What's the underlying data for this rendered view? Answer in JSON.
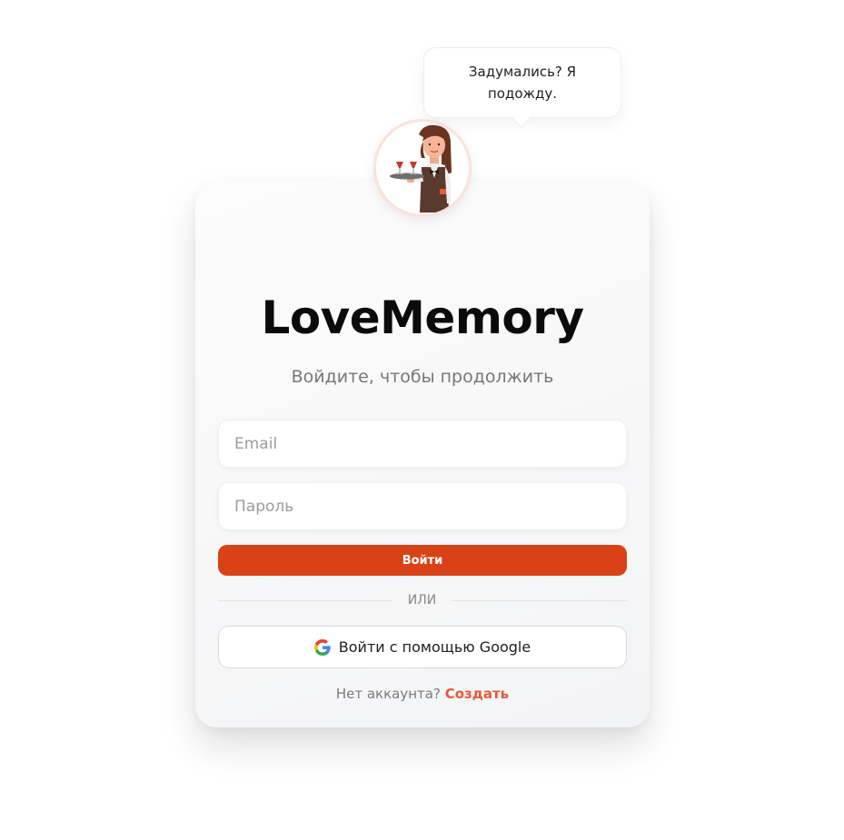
{
  "bubble": {
    "text": "Задумались? Я подожду."
  },
  "avatar": {
    "icon": "waitress-illustration-icon"
  },
  "login": {
    "title": "LoveMemory",
    "subtitle": "Войдите, чтобы продолжить",
    "email_placeholder": "Email",
    "password_placeholder": "Пароль",
    "submit_label": "Войти",
    "divider_text": "ИЛИ",
    "google_label": "Войти с помощью Google",
    "signup_prompt": "Нет аккаунта?",
    "signup_link": "Создать"
  },
  "colors": {
    "primary": "#d94216",
    "link": "#e8573a",
    "avatar_border": "#fbe2da"
  }
}
